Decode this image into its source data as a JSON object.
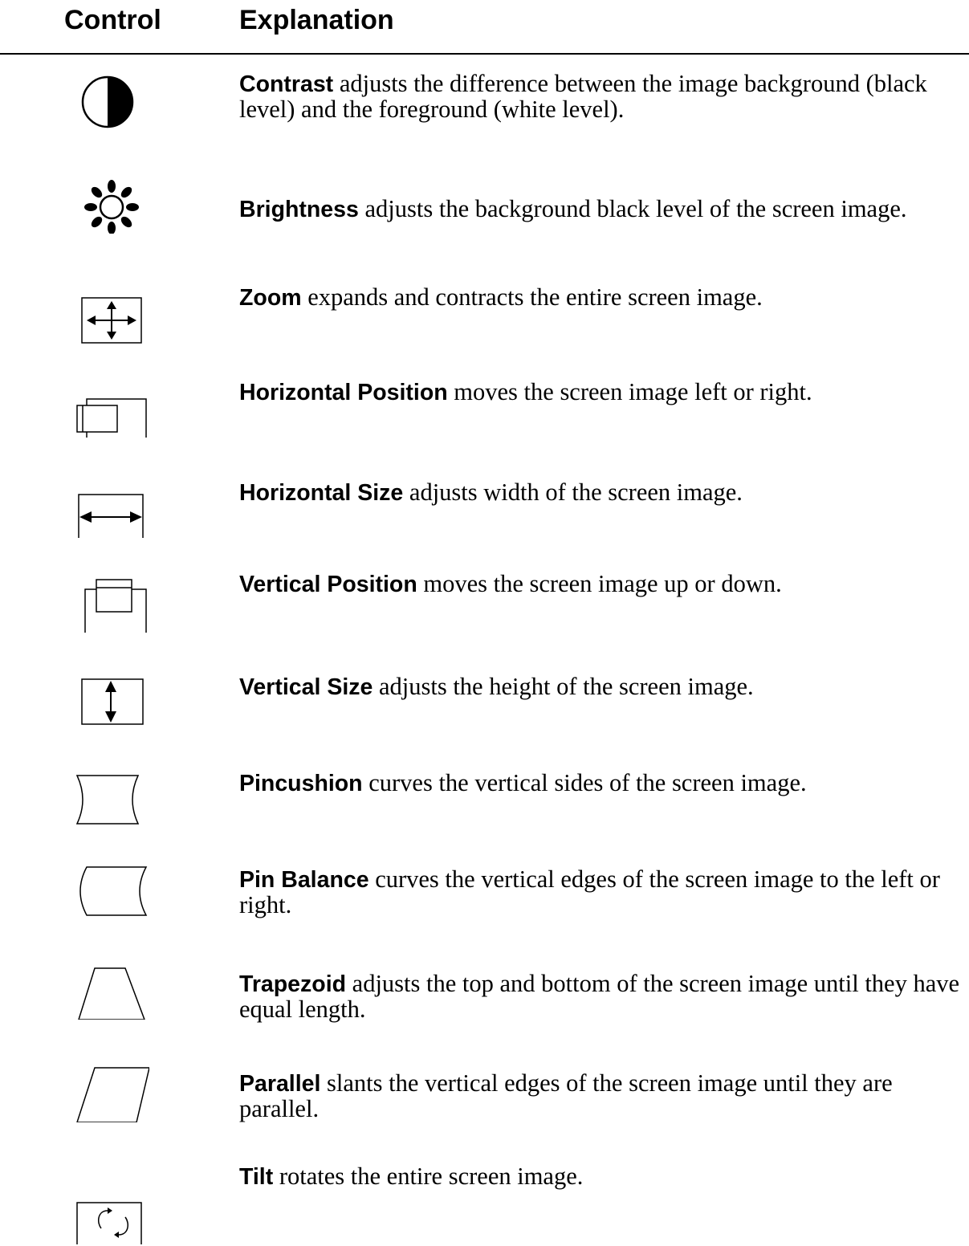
{
  "header": {
    "control": "Control",
    "explanation": "Explanation"
  },
  "rows": [
    {
      "icon": "contrast-icon",
      "term": "Contrast",
      "text": " adjusts the difference between the image background (black level) and the foreground (white level)."
    },
    {
      "icon": "brightness-icon",
      "term": "Brightness",
      "text": " adjusts the background black level of the screen image."
    },
    {
      "icon": "zoom-icon",
      "term": "Zoom",
      "text": " expands and contracts the entire screen image."
    },
    {
      "icon": "horizontal-position-icon",
      "term": "Horizontal Position",
      "text": " moves the screen image left or right."
    },
    {
      "icon": "horizontal-size-icon",
      "term": "Horizontal Size",
      "text": " adjusts width of the screen image."
    },
    {
      "icon": "vertical-position-icon",
      "term": "Vertical Position",
      "text": " moves the screen image up or down."
    },
    {
      "icon": "vertical-size-icon",
      "term": "Vertical Size",
      "text": " adjusts the height of the screen image."
    },
    {
      "icon": "pincushion-icon",
      "term": "Pincushion",
      "text": " curves the vertical sides of the screen image."
    },
    {
      "icon": "pin-balance-icon",
      "term": "Pin Balance",
      "text": " curves the vertical edges of the screen image to the left or right."
    },
    {
      "icon": "trapezoid-icon",
      "term": "Trapezoid",
      "text": " adjusts the top and bottom of the screen image until they have equal length."
    },
    {
      "icon": "parallel-icon",
      "term": "Parallel",
      "text": " slants the vertical edges of the screen image until they are parallel."
    },
    {
      "icon": "tilt-icon",
      "term": "Tilt",
      "text": " rotates the entire screen image."
    }
  ]
}
